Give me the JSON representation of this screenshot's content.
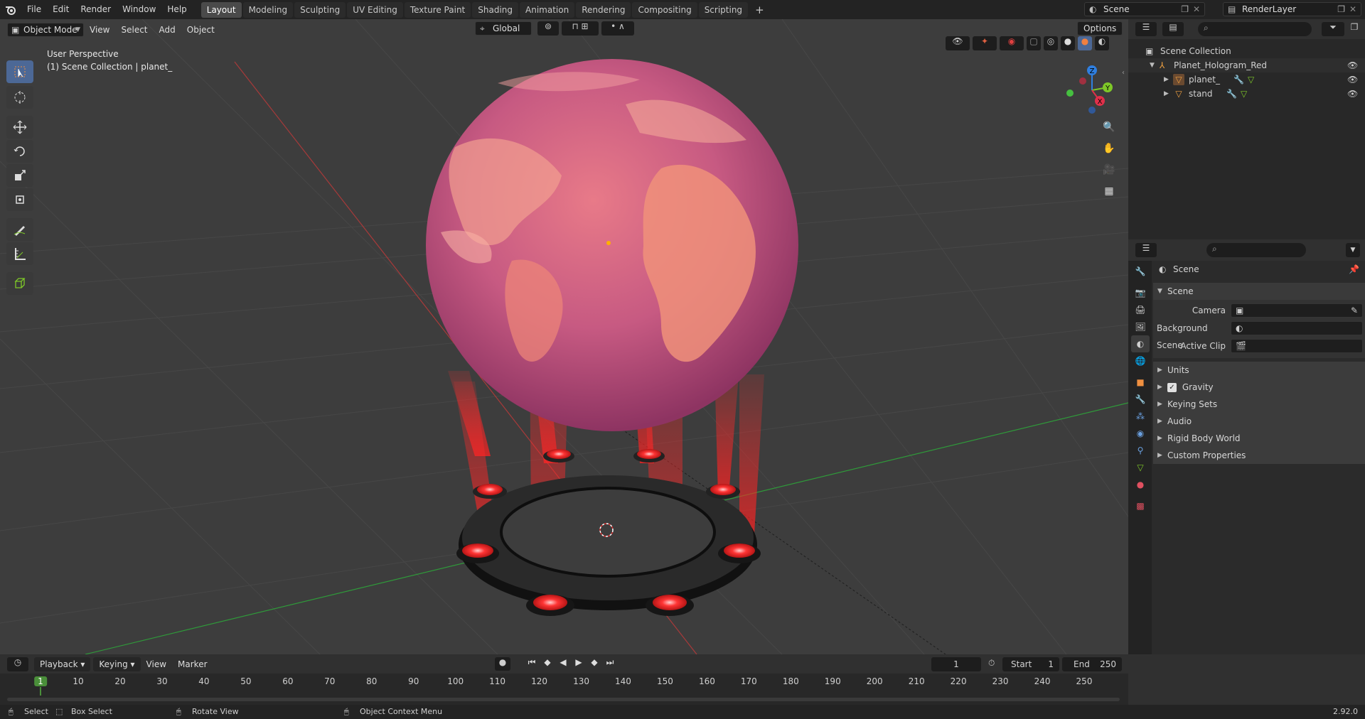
{
  "menubar": {
    "file": "File",
    "edit": "Edit",
    "render": "Render",
    "window": "Window",
    "help": "Help",
    "workspaces": [
      "Layout",
      "Modeling",
      "Sculpting",
      "UV Editing",
      "Texture Paint",
      "Shading",
      "Animation",
      "Rendering",
      "Compositing",
      "Scripting"
    ],
    "active_workspace": "Layout",
    "add_tab": "+",
    "scene": "Scene",
    "view_layer": "RenderLayer"
  },
  "viewport": {
    "mode": "Object Mode",
    "menus": {
      "view": "View",
      "select": "Select",
      "add": "Add",
      "object": "Object"
    },
    "orientation": "Global",
    "options": "Options",
    "overlay_title": "User Perspective",
    "overlay_subtitle": "(1) Scene Collection | planet_",
    "gizmo": {
      "x": "X",
      "y": "Y",
      "z": "Z"
    }
  },
  "outliner": {
    "root": "Scene Collection",
    "collection": "Planet_Hologram_Red",
    "objects": [
      "planet_",
      "stand"
    ]
  },
  "properties": {
    "context": "Scene",
    "panel": "Scene",
    "camera_label": "Camera",
    "background_scene_label": "Background Scene",
    "active_clip_label": "Active Clip",
    "subpanels": [
      "Units",
      "Gravity",
      "Keying Sets",
      "Audio",
      "Rigid Body World",
      "Custom Properties"
    ],
    "gravity_checked": true
  },
  "timeline": {
    "menus": {
      "playback": "Playback",
      "keying": "Keying",
      "view": "View",
      "marker": "Marker"
    },
    "current_frame": "1",
    "start_label": "Start",
    "start": "1",
    "end_label": "End",
    "end": "250",
    "ticks": [
      "1",
      "10",
      "20",
      "30",
      "40",
      "50",
      "60",
      "70",
      "80",
      "90",
      "100",
      "110",
      "120",
      "130",
      "140",
      "150",
      "160",
      "170",
      "180",
      "190",
      "200",
      "210",
      "220",
      "230",
      "240",
      "250"
    ]
  },
  "statusbar": {
    "select": "Select",
    "box_select": "Box Select",
    "rotate_view": "Rotate View",
    "context_menu": "Object Context Menu",
    "version": "2.92.0"
  },
  "colors": {
    "accent_active": "#4c6896",
    "planet_light": "#f09080",
    "planet_dark": "#b04a78",
    "beam": "#ff2828",
    "axis_x": "#e0304a",
    "axis_y": "#7ec828",
    "axis_z": "#2f7fe0"
  }
}
